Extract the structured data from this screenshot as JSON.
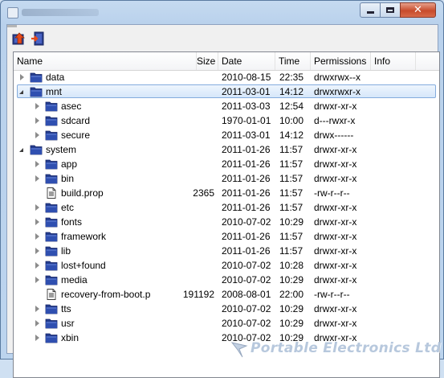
{
  "columns": [
    {
      "id": "name",
      "label": "Name"
    },
    {
      "id": "size",
      "label": "Size"
    },
    {
      "id": "date",
      "label": "Date"
    },
    {
      "id": "time",
      "label": "Time"
    },
    {
      "id": "permissions",
      "label": "Permissions"
    },
    {
      "id": "info",
      "label": "Info"
    }
  ],
  "toolbar": {
    "up_icon": "folder-up-icon",
    "exit_icon": "exit-door-icon",
    "disabled_icon": "minus-icon"
  },
  "watermark": {
    "text": "Portable Electronics Ltd"
  },
  "rows": [
    {
      "name": "data",
      "type": "folder",
      "depth": 0,
      "expander": "closed",
      "size": "",
      "date": "2010-08-15",
      "time": "22:35",
      "perm": "drwxrwx--x",
      "selected": false
    },
    {
      "name": "mnt",
      "type": "folder",
      "depth": 0,
      "expander": "open",
      "size": "",
      "date": "2011-03-01",
      "time": "14:12",
      "perm": "drwxrwxr-x",
      "selected": true
    },
    {
      "name": "asec",
      "type": "folder",
      "depth": 1,
      "expander": "closed",
      "size": "",
      "date": "2011-03-03",
      "time": "12:54",
      "perm": "drwxr-xr-x",
      "selected": false
    },
    {
      "name": "sdcard",
      "type": "folder",
      "depth": 1,
      "expander": "closed",
      "size": "",
      "date": "1970-01-01",
      "time": "10:00",
      "perm": "d---rwxr-x",
      "selected": false
    },
    {
      "name": "secure",
      "type": "folder",
      "depth": 1,
      "expander": "closed",
      "size": "",
      "date": "2011-03-01",
      "time": "14:12",
      "perm": "drwx------",
      "selected": false
    },
    {
      "name": "system",
      "type": "folder",
      "depth": 0,
      "expander": "open",
      "size": "",
      "date": "2011-01-26",
      "time": "11:57",
      "perm": "drwxr-xr-x",
      "selected": false
    },
    {
      "name": "app",
      "type": "folder",
      "depth": 1,
      "expander": "closed",
      "size": "",
      "date": "2011-01-26",
      "time": "11:57",
      "perm": "drwxr-xr-x",
      "selected": false
    },
    {
      "name": "bin",
      "type": "folder",
      "depth": 1,
      "expander": "closed",
      "size": "",
      "date": "2011-01-26",
      "time": "11:57",
      "perm": "drwxr-xr-x",
      "selected": false
    },
    {
      "name": "build.prop",
      "type": "file",
      "depth": 1,
      "expander": "none",
      "size": "2365",
      "date": "2011-01-26",
      "time": "11:57",
      "perm": "-rw-r--r--",
      "selected": false
    },
    {
      "name": "etc",
      "type": "folder",
      "depth": 1,
      "expander": "closed",
      "size": "",
      "date": "2011-01-26",
      "time": "11:57",
      "perm": "drwxr-xr-x",
      "selected": false
    },
    {
      "name": "fonts",
      "type": "folder",
      "depth": 1,
      "expander": "closed",
      "size": "",
      "date": "2010-07-02",
      "time": "10:29",
      "perm": "drwxr-xr-x",
      "selected": false
    },
    {
      "name": "framework",
      "type": "folder",
      "depth": 1,
      "expander": "closed",
      "size": "",
      "date": "2011-01-26",
      "time": "11:57",
      "perm": "drwxr-xr-x",
      "selected": false
    },
    {
      "name": "lib",
      "type": "folder",
      "depth": 1,
      "expander": "closed",
      "size": "",
      "date": "2011-01-26",
      "time": "11:57",
      "perm": "drwxr-xr-x",
      "selected": false
    },
    {
      "name": "lost+found",
      "type": "folder",
      "depth": 1,
      "expander": "closed",
      "size": "",
      "date": "2010-07-02",
      "time": "10:28",
      "perm": "drwxr-xr-x",
      "selected": false
    },
    {
      "name": "media",
      "type": "folder",
      "depth": 1,
      "expander": "closed",
      "size": "",
      "date": "2010-07-02",
      "time": "10:29",
      "perm": "drwxr-xr-x",
      "selected": false
    },
    {
      "name": "recovery-from-boot.p",
      "type": "file",
      "depth": 1,
      "expander": "none",
      "size": "191192",
      "date": "2008-08-01",
      "time": "22:00",
      "perm": "-rw-r--r--",
      "selected": false
    },
    {
      "name": "tts",
      "type": "folder",
      "depth": 1,
      "expander": "closed",
      "size": "",
      "date": "2010-07-02",
      "time": "10:29",
      "perm": "drwxr-xr-x",
      "selected": false
    },
    {
      "name": "usr",
      "type": "folder",
      "depth": 1,
      "expander": "closed",
      "size": "",
      "date": "2010-07-02",
      "time": "10:29",
      "perm": "drwxr-xr-x",
      "selected": false
    },
    {
      "name": "xbin",
      "type": "folder",
      "depth": 1,
      "expander": "closed",
      "size": "",
      "date": "2010-07-02",
      "time": "10:29",
      "perm": "drwxr-xr-x",
      "selected": false
    }
  ]
}
